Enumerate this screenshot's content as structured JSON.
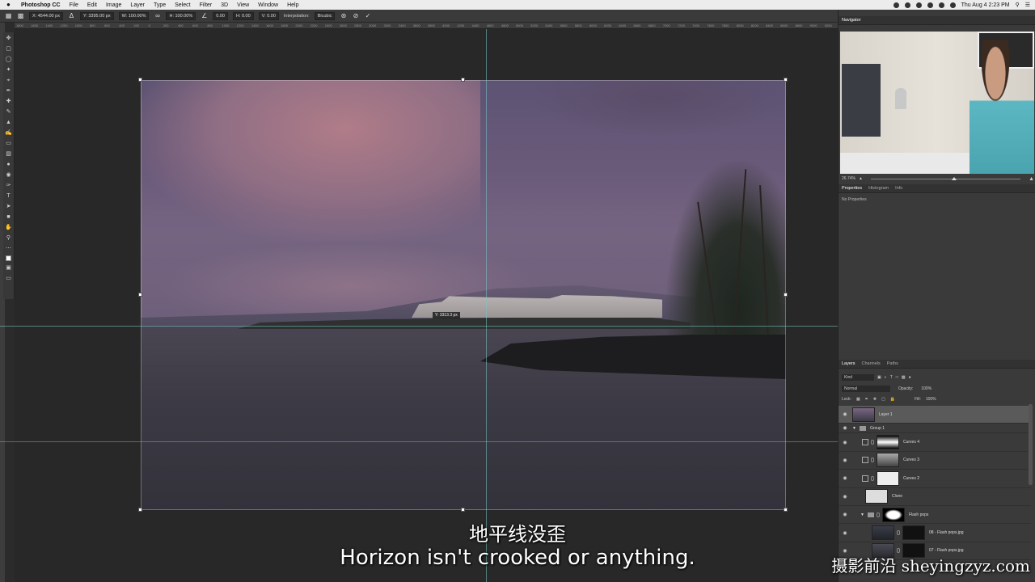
{
  "menubar": {
    "app_name": "Photoshop CC",
    "items": [
      "File",
      "Edit",
      "Image",
      "Layer",
      "Type",
      "Select",
      "Filter",
      "3D",
      "View",
      "Window",
      "Help"
    ],
    "clock": "Thu Aug 4  2:23 PM"
  },
  "options": {
    "x": "X: 4544.00 px",
    "y": "Y: 3395.00 px",
    "w": "W: 100.00%",
    "h": "H: 100.00%",
    "angle": "0.00",
    "hskew": "H: 0.00",
    "vskew": "V: 0.00",
    "interpolation_label": "Interpolation:",
    "interpolation_value": "Bicubic"
  },
  "ruler_ticks": [
    "1800",
    "1600",
    "1400",
    "1200",
    "1000",
    "800",
    "600",
    "400",
    "200",
    "0",
    "200",
    "400",
    "600",
    "800",
    "1000",
    "1200",
    "1400",
    "1600",
    "1800",
    "2000",
    "2200",
    "2400",
    "2600",
    "2800",
    "3000",
    "3200",
    "3400",
    "3600",
    "3800",
    "4000",
    "4200",
    "4400",
    "4600",
    "4800",
    "5000",
    "5200",
    "5400",
    "5600",
    "5800",
    "6000",
    "6200",
    "6400",
    "6600",
    "6800",
    "7000",
    "7200",
    "7400",
    "7600",
    "7800",
    "8000",
    "8200",
    "8400",
    "8600",
    "8800",
    "9000",
    "9200"
  ],
  "canvas": {
    "tooltip": "Y: 3313.3 px"
  },
  "navigator": {
    "title": "Navigator",
    "zoom": "26.74%"
  },
  "properties": {
    "tabs": [
      "Properties",
      "Histogram",
      "Info"
    ],
    "body": "No Properties"
  },
  "layers_panel": {
    "tabs": [
      "Layers",
      "Channels",
      "Paths"
    ],
    "filter_kind": "Kind",
    "blend_mode": "Normal",
    "opacity_label": "Opacity:",
    "opacity_value": "100%",
    "lock_label": "Lock:",
    "fill_label": "Fill:",
    "fill_value": "100%",
    "layers": [
      {
        "name": "Layer 1",
        "selected": true
      },
      {
        "name": "Group 1",
        "selected": false
      },
      {
        "name": "Curves 4",
        "selected": false
      },
      {
        "name": "Curves 3",
        "selected": false
      },
      {
        "name": "Curves 2",
        "selected": false
      },
      {
        "name": "Clone",
        "selected": false
      },
      {
        "name": "Flash pops",
        "selected": false
      },
      {
        "name": "08 - Flash pops.jpg",
        "selected": false
      },
      {
        "name": "07 - Flash pops.jpg",
        "selected": false
      }
    ]
  },
  "subtitles": {
    "chinese": "地平线没歪",
    "english": "Horizon isn't crooked or anything."
  },
  "watermark": "摄影前沿 sheyingzyz.com"
}
